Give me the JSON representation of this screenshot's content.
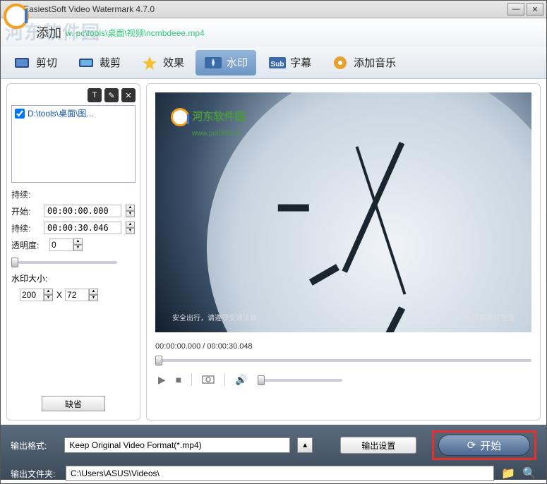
{
  "window": {
    "title": "EasiestSoft Video Watermark 4.7.0"
  },
  "header": {
    "overlay_brand": "河东软件园",
    "add_label": "添加",
    "file_path": "w. pc\\tools\\桌面\\视频\\ncmbdeee.mp4"
  },
  "tabs": {
    "cut": "剪切",
    "crop": "裁剪",
    "effect": "效果",
    "watermark": "水印",
    "subtitle": "字幕",
    "music": "添加音乐"
  },
  "sidebar": {
    "file_entry": "D:\\tools\\桌面\\图...",
    "duration_label": "持续:",
    "start_label": "开始:",
    "start_value": "00:00:00.000",
    "dur2_label": "持续:",
    "dur2_value": "00:00:30.046",
    "opacity_label": "透明度:",
    "opacity_value": "0",
    "size_label": "水印大小:",
    "size_w": "200",
    "size_x": "X",
    "size_h": "72",
    "defaults": "缺省"
  },
  "preview": {
    "wm_brand": "河东软件园",
    "wm_url": "www.pc0359.cn",
    "caption_left": "安全出行，请遵守交通法规",
    "caption_right": "广告 提倡美好生活",
    "timecode": "00:00:00.000 / 00:00:30.048"
  },
  "bottom": {
    "format_label": "输出格式:",
    "format_value": "Keep Original Video Format(*.mp4)",
    "settings": "输出设置",
    "start": "开始",
    "folder_label": "输出文件夹:",
    "folder_value": "C:\\Users\\ASUS\\Videos\\"
  }
}
